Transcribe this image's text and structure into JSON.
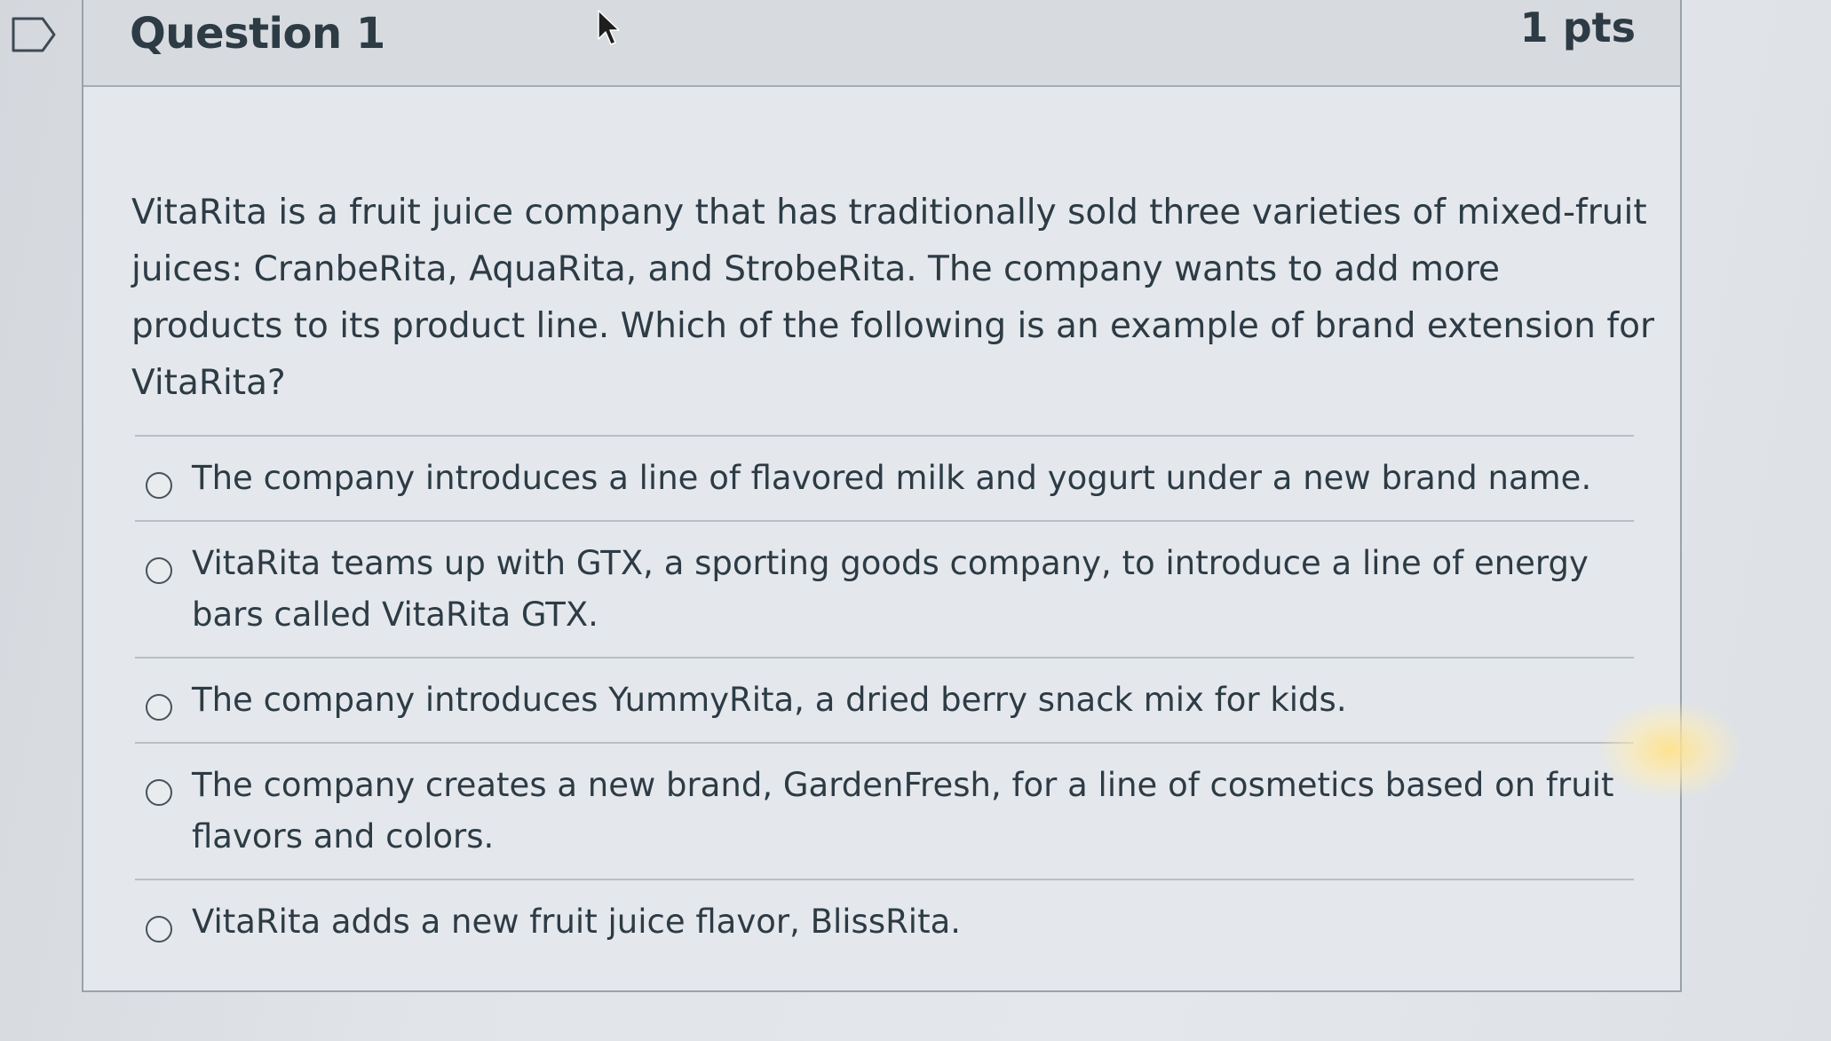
{
  "question": {
    "title": "Question 1",
    "points": "1 pts",
    "text": "VitaRita is a fruit juice company that has traditionally sold three varieties of mixed-fruit juices: CranbeRita, AquaRita, and StrobeRita. The company wants to add more products to its product line. Which of the following is an example of brand extension for VitaRita?"
  },
  "answers": [
    {
      "label": "The company introduces a line of flavored milk and yogurt under a new brand name.",
      "selected": false
    },
    {
      "label": "VitaRita teams up with GTX, a sporting goods company, to introduce a line of energy bars called VitaRita GTX.",
      "selected": false
    },
    {
      "label": "The company introduces YummyRita, a dried berry snack mix for kids.",
      "selected": false
    },
    {
      "label": "The company creates a new brand, GardenFresh, for a line of cosmetics based on fruit flavors and colors.",
      "selected": false
    },
    {
      "label": "VitaRita adds a new fruit juice flavor, BlissRita.",
      "selected": false
    }
  ],
  "icons": {
    "bookmark": "bookmark-flag-icon",
    "cursor": "mouse-pointer-icon",
    "radio": "radio-unchecked-icon"
  }
}
